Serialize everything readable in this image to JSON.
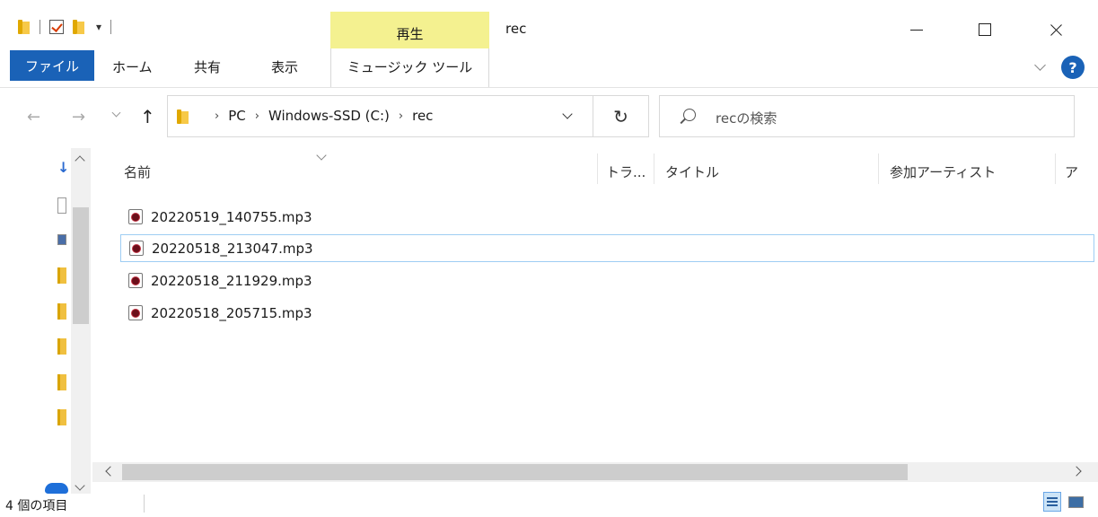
{
  "window": {
    "title": "rec",
    "context_tab_label": "再生",
    "qat_dropdown": "▾"
  },
  "ribbon": {
    "file_label": "ファイル",
    "tabs": [
      "ホーム",
      "共有",
      "表示"
    ],
    "context_tab_label": "ミュージック ツール",
    "help_label": "?"
  },
  "nav": {
    "back": "←",
    "forward": "→",
    "up": "↑",
    "refresh": "↻",
    "breadcrumbs": [
      "PC",
      "Windows-SSD (C:)",
      "rec"
    ],
    "crumb_separator": "›",
    "search_placeholder": "recの検索"
  },
  "columns": {
    "name": "名前",
    "track": "トラ...",
    "title": "タイトル",
    "artist": "参加アーティスト",
    "more": "ア"
  },
  "files": [
    {
      "name": "20220519_140755.mp3"
    },
    {
      "name": "20220518_213047.mp3",
      "selected": true
    },
    {
      "name": "20220518_211929.mp3"
    },
    {
      "name": "20220518_205715.mp3"
    }
  ],
  "statusbar": {
    "item_count": "4 個の項目"
  },
  "colors": {
    "file_tab": "#1a62b7",
    "context_tab": "#f4f190",
    "selection_border": "#9ecdf3"
  }
}
